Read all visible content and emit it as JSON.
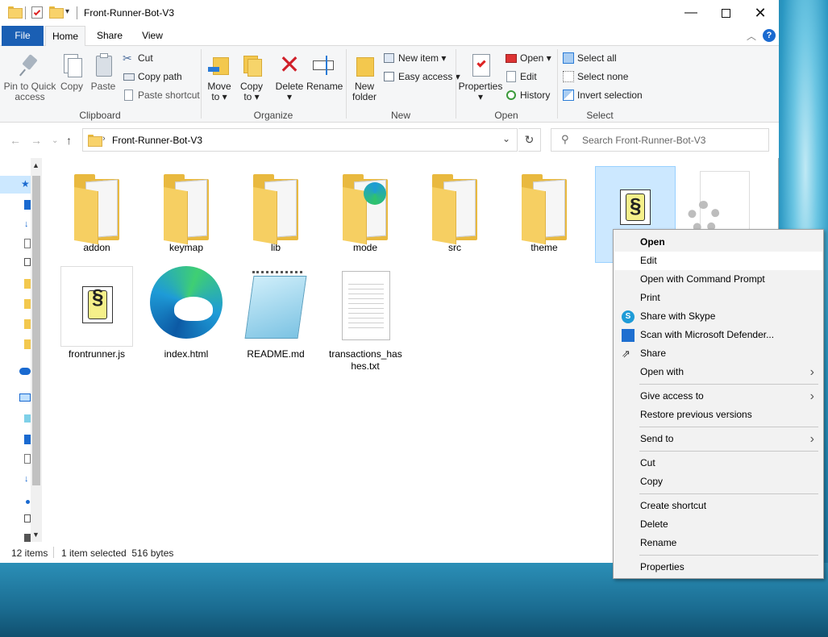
{
  "window": {
    "title": "Front-Runner-Bot-V3",
    "minimize_icon": "minimize-icon",
    "maximize_icon": "maximize-icon",
    "close_icon": "close-icon"
  },
  "tabs": [
    "File",
    "Home",
    "Share",
    "View"
  ],
  "ribbon": {
    "clipboard": {
      "label": "Clipboard",
      "pin": "Pin to Quick access",
      "pin_l1": "Pin to Quick",
      "pin_l2": "access",
      "copy": "Copy",
      "paste": "Paste",
      "cut": "Cut",
      "copy_path": "Copy path",
      "paste_shortcut": "Paste shortcut"
    },
    "organize": {
      "label": "Organize",
      "move_to_l1": "Move",
      "move_to_l2": "to",
      "copy_to_l1": "Copy",
      "copy_to_l2": "to",
      "delete": "Delete",
      "rename": "Rename"
    },
    "new": {
      "label": "New",
      "new_folder_l1": "New",
      "new_folder_l2": "folder",
      "new_item": "New item",
      "easy_access": "Easy access"
    },
    "open": {
      "label": "Open",
      "properties": "Properties",
      "open": "Open",
      "edit": "Edit",
      "history": "History"
    },
    "select": {
      "label": "Select",
      "select_all": "Select all",
      "select_none": "Select none",
      "invert": "Invert selection"
    }
  },
  "address": {
    "path": "Front-Runner-Bot-V3",
    "search_placeholder": "Search Front-Runner-Bot-V3"
  },
  "files": [
    {
      "name": "addon",
      "type": "folder"
    },
    {
      "name": "keymap",
      "type": "folder"
    },
    {
      "name": "lib",
      "type": "folder"
    },
    {
      "name": "mode",
      "type": "folder"
    },
    {
      "name": "src",
      "type": "folder"
    },
    {
      "name": "theme",
      "type": "folder"
    },
    {
      "name": "",
      "type": "script",
      "selected": true
    },
    {
      "name": "",
      "type": "settings-file"
    },
    {
      "name": "frontrunner.js",
      "type": "script"
    },
    {
      "name": "index.html",
      "type": "edge"
    },
    {
      "name": "README.md",
      "type": "notepad"
    },
    {
      "name": "transactions_hashes.txt",
      "name_l1": "transactions_has",
      "name_l2": "hes.txt",
      "type": "text"
    }
  ],
  "status": {
    "count": "12 items",
    "selection": "1 item selected  516 bytes"
  },
  "context_menu": {
    "items": [
      "Open",
      "Edit",
      "Open with Command Prompt",
      "Print",
      "Share with Skype",
      "Scan with Microsoft Defender...",
      "Share",
      "Open with",
      "Give access to",
      "Restore previous versions",
      "Send to",
      "Cut",
      "Copy",
      "Create shortcut",
      "Delete",
      "Rename",
      "Properties"
    ],
    "highlighted": "Edit"
  },
  "colors": {
    "accent": "#1a5fb4",
    "selection": "#cce8ff",
    "folder": "#e9b93f"
  }
}
